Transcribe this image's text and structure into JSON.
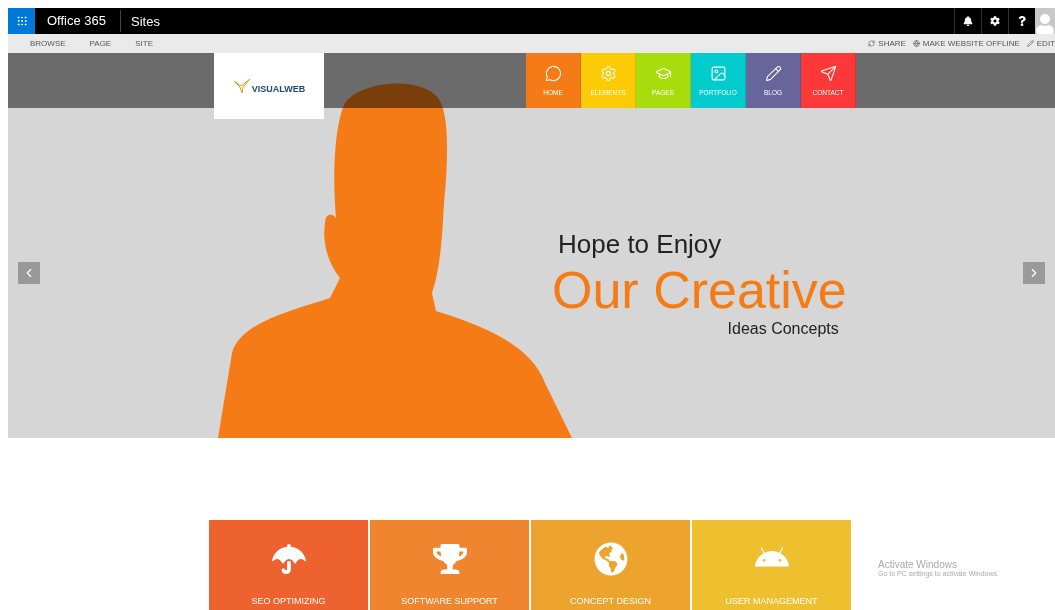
{
  "suite_bar": {
    "brand": "Office 365",
    "app": "Sites"
  },
  "ribbon": {
    "tabs": [
      "BROWSE",
      "PAGE",
      "SITE"
    ],
    "actions": [
      {
        "kind": "share",
        "label": "SHARE"
      },
      {
        "kind": "offline",
        "label": "MAKE WEBSITE OFFLINE"
      },
      {
        "kind": "edit",
        "label": "EDIT"
      }
    ]
  },
  "logo": {
    "text": "VISUALWEB"
  },
  "nav": [
    {
      "kind": "chat",
      "label": "HOME",
      "color": "#f57b17"
    },
    {
      "kind": "gear",
      "label": "ELEMENTS",
      "color": "#fdcb05"
    },
    {
      "kind": "cap",
      "label": "PAGES",
      "color": "#a9dc0c"
    },
    {
      "kind": "image",
      "label": "PORTFOLIO",
      "color": "#04ccce"
    },
    {
      "kind": "pencil",
      "label": "BLOG",
      "color": "#68659a"
    },
    {
      "kind": "plane",
      "label": "CONTACT",
      "color": "#fc3838"
    }
  ],
  "hero": {
    "line_1": "Hope to Enjoy",
    "line_2": "Our Creative",
    "line_3": "Ideas Concepts"
  },
  "services": [
    {
      "kind": "umbrella",
      "title": "SEO OPTIMIZING",
      "color": "#ee622f"
    },
    {
      "kind": "trophy",
      "title": "SOFTWARE SUPPORT",
      "color": "#ef862f"
    },
    {
      "kind": "globe",
      "title": "CONCEPT DESIGN",
      "color": "#eda42f"
    },
    {
      "kind": "android",
      "title": "USER MANAGEMENT",
      "color": "#eec02f"
    }
  ],
  "os_notice": {
    "title": "Activate Windows",
    "text": "Go to PC settings to activate Windows."
  }
}
